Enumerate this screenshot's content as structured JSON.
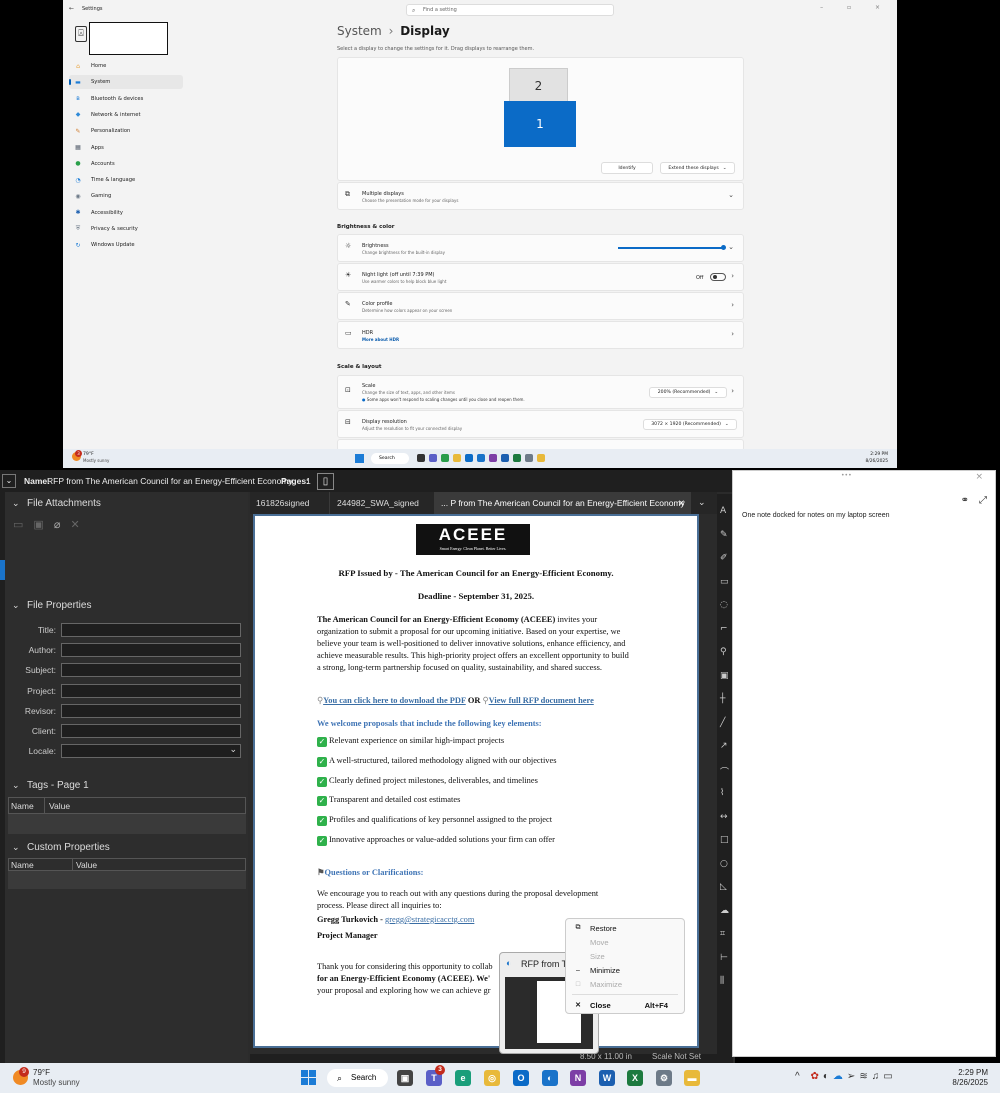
{
  "settings": {
    "app_title": "Settings",
    "search_placeholder": "Find a setting",
    "win_controls": "– ▫ ×",
    "breadcrumb_parent": "System",
    "breadcrumb_sep": "›",
    "page_title": "Display",
    "instruction": "Select a display to change the settings for it. Drag displays to rearrange them.",
    "monitor_2": "2",
    "monitor_1": "1",
    "identify_label": "Identify",
    "extend_label": "Extend these displays",
    "sidebar": [
      {
        "icon": "home-icon",
        "glyph": "⌂",
        "label": "Home",
        "color": "#e8a13a"
      },
      {
        "icon": "system-icon",
        "glyph": "▬",
        "label": "System",
        "color": "#1c7cd6"
      },
      {
        "icon": "bluetooth-icon",
        "glyph": "ʙ",
        "label": "Bluetooth & devices",
        "color": "#1c7cd6"
      },
      {
        "icon": "network-icon",
        "glyph": "◆",
        "label": "Network & internet",
        "color": "#2f8ad8"
      },
      {
        "icon": "personalization-icon",
        "glyph": "✎",
        "label": "Personalization",
        "color": "#d07a2a"
      },
      {
        "icon": "apps-icon",
        "glyph": "▦",
        "label": "Apps",
        "color": "#555f6d"
      },
      {
        "icon": "accounts-icon",
        "glyph": "●",
        "label": "Accounts",
        "color": "#2aa04a"
      },
      {
        "icon": "time-language-icon",
        "glyph": "◔",
        "label": "Time & language",
        "color": "#1c7cd6"
      },
      {
        "icon": "gaming-icon",
        "glyph": "◉",
        "label": "Gaming",
        "color": "#6d7a88"
      },
      {
        "icon": "accessibility-icon",
        "glyph": "✱",
        "label": "Accessibility",
        "color": "#1c5fb0"
      },
      {
        "icon": "privacy-icon",
        "glyph": "⛨",
        "label": "Privacy & security",
        "color": "#6d7a88"
      },
      {
        "icon": "windows-update-icon",
        "glyph": "↻",
        "label": "Windows Update",
        "color": "#1c7cd6"
      }
    ],
    "multiple_displays": {
      "title": "Multiple displays",
      "sub": "Choose the presentation mode for your displays"
    },
    "brightness_color_header": "Brightness & color",
    "brightness": {
      "title": "Brightness",
      "sub": "Change brightness for the built-in display",
      "level": 1.0
    },
    "night_light": {
      "title": "Night light (off until 7:39 PM)",
      "sub": "Use warmer colors to help block blue light",
      "state": "Off"
    },
    "color_profile": {
      "title": "Color profile",
      "sub": "Determine how colors appear on your screen"
    },
    "hdr": {
      "title": "HDR",
      "sub": "More about HDR"
    },
    "scale_layout_header": "Scale & layout",
    "scale": {
      "title": "Scale",
      "sub": "Change the size of text, apps, and other items",
      "warning": "Some apps won't respond to scaling changes until you close and reopen them.",
      "value": "200% (Recommended)"
    },
    "resolution": {
      "title": "Display resolution",
      "sub": "Adjust the resolution to fit your connected display",
      "value": "3072 × 1920 (Recommended)"
    }
  },
  "top_taskbar": {
    "temp": "79°F",
    "weather": "Mostly sunny",
    "search": "Search",
    "time": "2:29 PM",
    "date": "8/26/2025",
    "badge": "3"
  },
  "pdf": {
    "name_label": "Name:",
    "doc_name": "RFP from The American Council for an Energy-Efficient Economy",
    "pages_label": "Pages:",
    "pages_value": "1",
    "file_attachments": "File Attachments",
    "file_properties": "File Properties",
    "props": [
      "Title:",
      "Author:",
      "Subject:",
      "Project:",
      "Revisor:",
      "Client:",
      "Locale:"
    ],
    "tags_header": "Tags - Page 1",
    "col_name": "Name",
    "col_value": "Value",
    "custom_props": "Custom Properties",
    "tabs": [
      "161826signed",
      "244982_SWA_signed",
      "... P from The American Council for an Energy-Efficient Economy"
    ],
    "tab_close": "✕",
    "status_size": "8.50 x 11.00 in",
    "status_scale": "Scale Not Set"
  },
  "document": {
    "logo_text": "ACEEE",
    "logo_tagline": "Smart Energy. Clean Planet. Better Lives.",
    "heading": "RFP Issued by - The American Council for an Energy-Efficient Economy.",
    "deadline": "Deadline - September 31, 2025.",
    "intro_bold": "The American Council for an Energy-Efficient Economy (ACEEE)",
    "intro_rest": " invites your organization to submit a proposal for our upcoming initiative. Based on your expertise, we believe your team is well-positioned to deliver innovative solutions, enhance efficiency, and achieve measurable results. This high-priority project offers an excellent opportunity to build a strong, long-term partnership focused on quality, sustainability, and shared success.",
    "link1": "You can click here to download the PDF",
    "or": " OR ",
    "link2": "View full RFP document here",
    "welcome": "We welcome proposals that include the following key elements:",
    "elements": [
      "Relevant experience on similar high-impact projects",
      "A well-structured, tailored methodology aligned with our objectives",
      "Clearly defined project milestones, deliverables, and timelines",
      "Transparent and detailed cost estimates",
      "Profiles and qualifications of key personnel assigned to the project",
      "Innovative approaches or value-added solutions your firm can offer"
    ],
    "questions": "Questions or Clarifications:",
    "encourage": "We encourage you to reach out with any questions during the proposal development process. Please direct all inquiries to:",
    "contact_name": "Gregg Turkovich - ",
    "contact_email": "gregg@strategicacctg.com",
    "contact_title": "Project Manager",
    "thanks_line1": "Thank you for considering this opportunity to collab",
    "thanks_line2": "for an Energy-Efficient Economy (ACEEE). We'",
    "thanks_line3": "your proposal and exploring how we can achieve gr"
  },
  "onenote": {
    "dots": "•••",
    "close": "×",
    "note": "One note docked for notes on my laptop screen"
  },
  "context_menu": {
    "restore": "Restore",
    "move": "Move",
    "size": "Size",
    "minimize": "Minimize",
    "maximize": "Maximize",
    "close": "Close",
    "close_shortcut": "Alt+F4"
  },
  "thumbnail": {
    "title": "RFP from T"
  },
  "taskbar": {
    "temp": "79°F",
    "weather": "Mostly sunny",
    "search": "Search",
    "time": "2:29 PM",
    "date": "8/26/2025",
    "badge_weather": "9",
    "badge_teams": "3"
  }
}
